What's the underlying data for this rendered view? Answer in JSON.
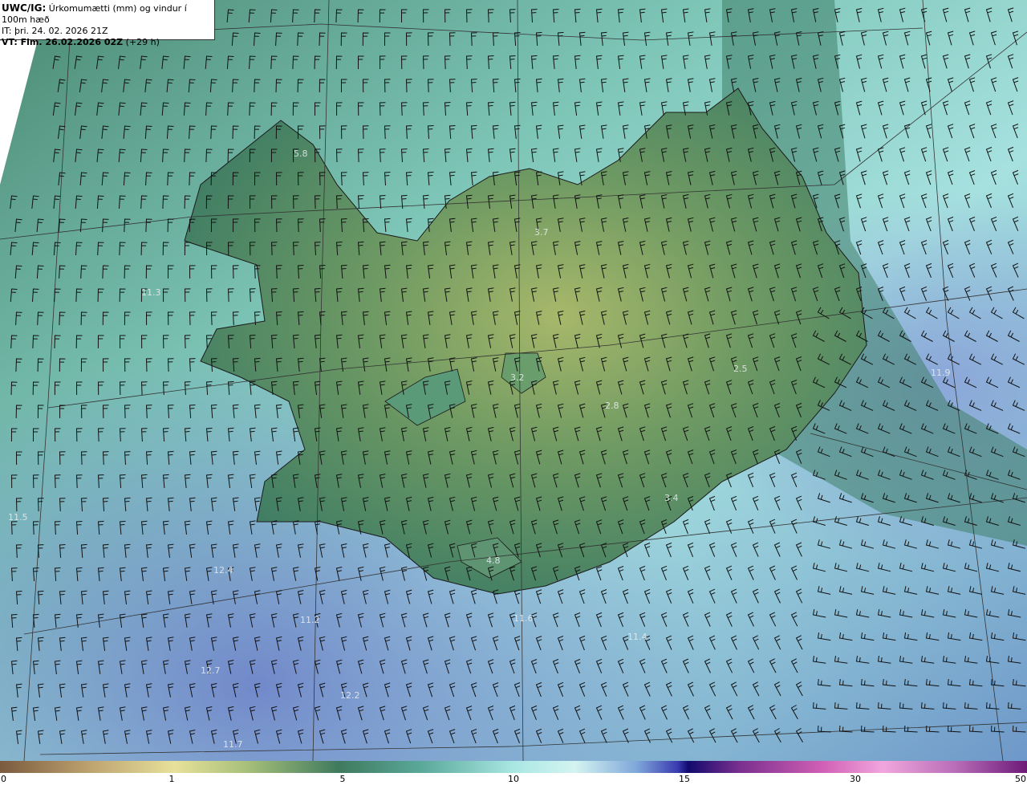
{
  "header": {
    "model": "UWC/IG:",
    "title": "Úrkomumætti (mm) og vindur í 100m hæð",
    "issue_time": "IT: þri. 24. 02. 2026 21Z",
    "valid_time_label": "VT: Fim. 26.02.2026 02Z",
    "valid_time_offset": "(+29 h)"
  },
  "map_labels": [
    {
      "text": "5.8"
    },
    {
      "text": "3.7"
    },
    {
      "text": "3.2"
    },
    {
      "text": "2.5"
    },
    {
      "text": "2.8"
    },
    {
      "text": "3.4"
    },
    {
      "text": "4.8"
    },
    {
      "text": "11.9"
    },
    {
      "text": "12.4"
    },
    {
      "text": "12.7"
    },
    {
      "text": "12.2"
    },
    {
      "text": "11.6"
    },
    {
      "text": "11.4"
    },
    {
      "text": "11.7"
    },
    {
      "text": "11.2"
    },
    {
      "text": "11.3"
    },
    {
      "text": "11.5"
    }
  ],
  "colorbar": {
    "ticks": [
      "0",
      "1",
      "5",
      "10",
      "15",
      "30",
      "50"
    ]
  },
  "colors": {
    "coastline": "#1a1a1a",
    "grid": "#333333",
    "barb": "#111111"
  }
}
